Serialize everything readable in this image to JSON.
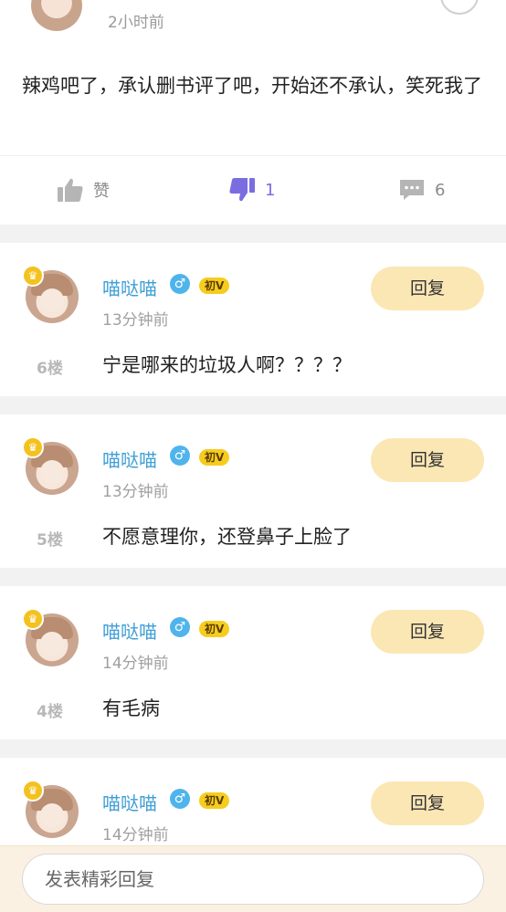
{
  "top_comment": {
    "time": "2小时前",
    "text": "辣鸡吧了，承认删书评了吧，开始还不承认，笑死我了",
    "actions": {
      "like_label": "赞",
      "dislike_count": "1",
      "comment_count": "6"
    }
  },
  "floors": [
    {
      "username": "喵哒喵",
      "gender_symbol": "♂",
      "level": "初V",
      "time": "13分钟前",
      "reply_label": "回复",
      "floor_label": "6楼",
      "text": "宁是哪来的垃圾人啊？？？？"
    },
    {
      "username": "喵哒喵",
      "gender_symbol": "♂",
      "level": "初V",
      "time": "13分钟前",
      "reply_label": "回复",
      "floor_label": "5楼",
      "text": "不愿意理你，还登鼻子上脸了"
    },
    {
      "username": "喵哒喵",
      "gender_symbol": "♂",
      "level": "初V",
      "time": "14分钟前",
      "reply_label": "回复",
      "floor_label": "4楼",
      "text": "有毛病"
    },
    {
      "username": "喵哒喵",
      "gender_symbol": "♂",
      "level": "初V",
      "time": "14分钟前",
      "reply_label": "回复",
      "floor_label": "",
      "text": ""
    }
  ],
  "composer": {
    "placeholder": "发表精彩回复"
  },
  "colors": {
    "accent_blue": "#3f9fd6",
    "reply_button_bg": "#fbe7b4",
    "level_badge": "#f6cc1f",
    "dislike_active": "#7a6de0"
  }
}
